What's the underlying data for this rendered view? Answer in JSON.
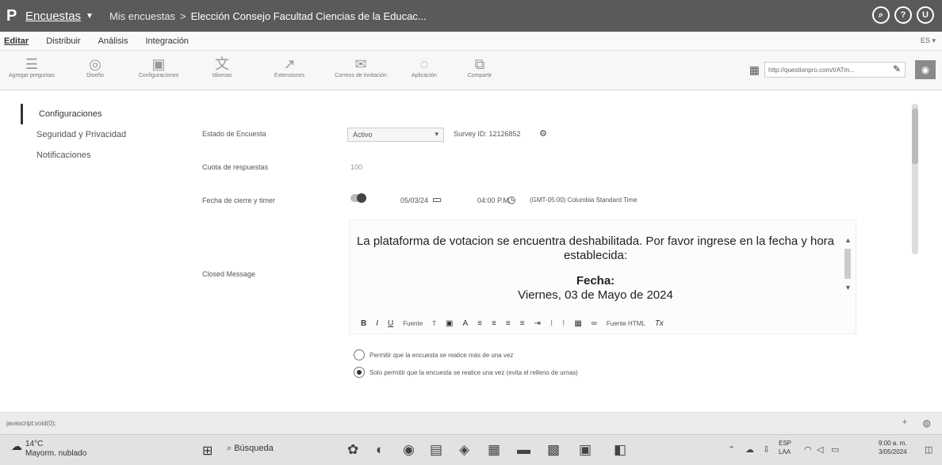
{
  "topbar": {
    "brand": "Encuestas",
    "breadcrumb_root": "Mis encuestas",
    "breadcrumb_sep": ">",
    "breadcrumb_current": "Elección Consejo Facultad Ciencias de la Educac...",
    "icons": [
      "search-icon",
      "help-icon",
      "user-icon"
    ]
  },
  "menubar": {
    "items": [
      "Editar",
      "Distribuir",
      "Análisis",
      "Integración"
    ],
    "lang": "ES ▾"
  },
  "toolbar": {
    "tools": [
      {
        "label": "Agregar preguntas",
        "icon": "questions-icon"
      },
      {
        "label": "Diseño",
        "icon": "design-icon"
      },
      {
        "label": "Configuraciones",
        "icon": "settings-icon"
      },
      {
        "label": "Idiomas",
        "icon": "languages-icon"
      },
      {
        "label": "Extensiones",
        "icon": "extensions-icon"
      },
      {
        "label": "Correos de invitación",
        "icon": "email-icon"
      },
      {
        "label": "Aplicación",
        "icon": "app-icon"
      },
      {
        "label": "Compartir",
        "icon": "share-icon"
      }
    ],
    "url": "http://questionpro.com/t/ATm..."
  },
  "sidebar": {
    "items": [
      "Configuraciones",
      "Seguridad y Privacidad",
      "Notificaciones"
    ]
  },
  "form": {
    "status_label": "Estado de Encuesta",
    "status_value": "Activo",
    "survey_id": "Survey ID: 12126852",
    "limit_label": "Cuota de respuestas",
    "limit_value": "100",
    "dates_label": "Fecha de cierre y timer",
    "date_value": "05/03/24",
    "time_value": "04:00 P.M.",
    "timezone": "(GMT-05:00) Columbia Standard Time",
    "closed_label": "Closed Message",
    "closed_line1": "La plataforma de votacion se encuentra deshabilitada. Por favor ingrese en la fecha y hora establecida:",
    "closed_fecha": "Fecha:",
    "closed_date": "Viernes, 03 de Mayo de 2024",
    "editor_toolbar": [
      "B",
      "I",
      "U",
      "Fuente",
      "T",
      "A",
      "Fuente HTML",
      "Tx"
    ],
    "radio1": "Permitir que la encuesta se realice más de una vez",
    "radio2": "Solo permitir que la encuesta se realice una vez (evita el relleno de urnas)"
  },
  "statusbar": {
    "text": "javascript:void(0);"
  },
  "taskbar": {
    "temp": "14°C",
    "weather": "Mayorm. nublado",
    "search": "Búsqueda",
    "lang": "ESP",
    "region": "LAA",
    "time": "9:00 a. m.",
    "date": "3/05/2024"
  }
}
